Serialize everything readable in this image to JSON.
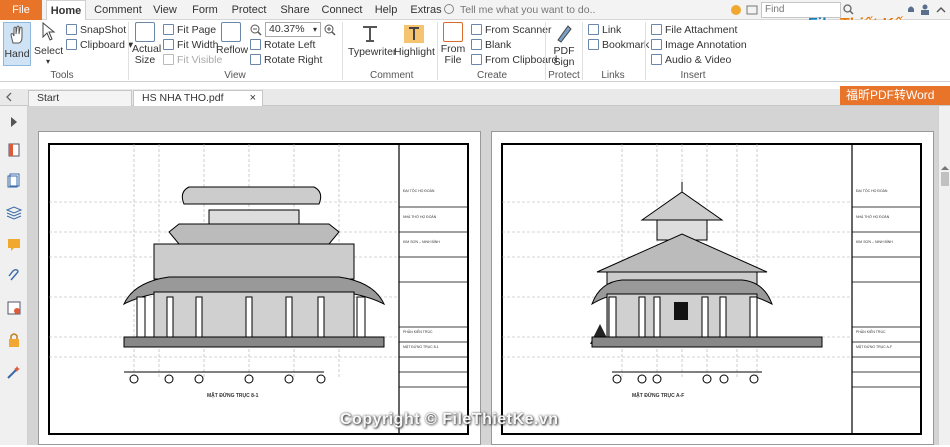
{
  "menu": {
    "file": "File",
    "tabs": [
      "Home",
      "Comment",
      "View",
      "Form",
      "Protect",
      "Share",
      "Connect",
      "Help",
      "Extras"
    ],
    "tell_me": "Tell me what you want to do..",
    "find_placeholder": "Find"
  },
  "logo": {
    "part1": "File",
    "part2": "Thiết Kế",
    "part3": ".vn"
  },
  "ribbon": {
    "tools": {
      "hand": "Hand",
      "select": "Select",
      "snapshot": "SnapShot",
      "clipboard": "Clipboard",
      "label": "Tools"
    },
    "view": {
      "actual_size": "Actual\nSize",
      "fit_page": "Fit Page",
      "fit_width": "Fit Width",
      "fit_visible": "Fit Visible",
      "reflow": "Reflow",
      "zoom": "40.37%",
      "rotate_left": "Rotate Left",
      "rotate_right": "Rotate Right",
      "label": "View"
    },
    "comment": {
      "typewriter": "Typewriter",
      "highlight": "Highlight",
      "label": "Comment"
    },
    "create": {
      "from_file": "From\nFile",
      "from_scanner": "From Scanner",
      "blank": "Blank",
      "from_clipboard": "From Clipboard",
      "label": "Create"
    },
    "protect": {
      "pdf_sign": "PDF\nSign",
      "label": "Protect"
    },
    "links": {
      "link": "Link",
      "bookmark": "Bookmark",
      "label": "Links"
    },
    "insert": {
      "file_attachment": "File Attachment",
      "image_annotation": "Image Annotation",
      "audio_video": "Audio & Video",
      "label": "Insert"
    }
  },
  "doc_tabs": [
    {
      "label": "Start"
    },
    {
      "label": "HS NHA THO.pdf"
    }
  ],
  "banner": "福昕PDF转Word",
  "pages": [
    {
      "title": "MẶT ĐỨNG TRỤC 8-1",
      "owner": "ĐẠI TỘC HỌ ĐOÀN",
      "project": "NHÀ THỜ HỌ ĐOÀN",
      "location": "KIM SƠN – NINH BÌNH",
      "phase": "PHẦN KIẾN TRÚC",
      "drawing": "MẶT ĐỨNG TRỤC 8-1"
    },
    {
      "title": "MẶT ĐỨNG TRỤC A-F",
      "owner": "ĐẠI TỘC HỌ ĐOÀN",
      "project": "NHÀ THỜ HỌ ĐOÀN",
      "location": "KIM SƠN – NINH BÌNH",
      "phase": "PHẦN KIẾN TRÚC",
      "drawing": "MẶT ĐỨNG TRỤC A-F"
    }
  ],
  "watermark": "Copyright © FileThietKe.vn"
}
